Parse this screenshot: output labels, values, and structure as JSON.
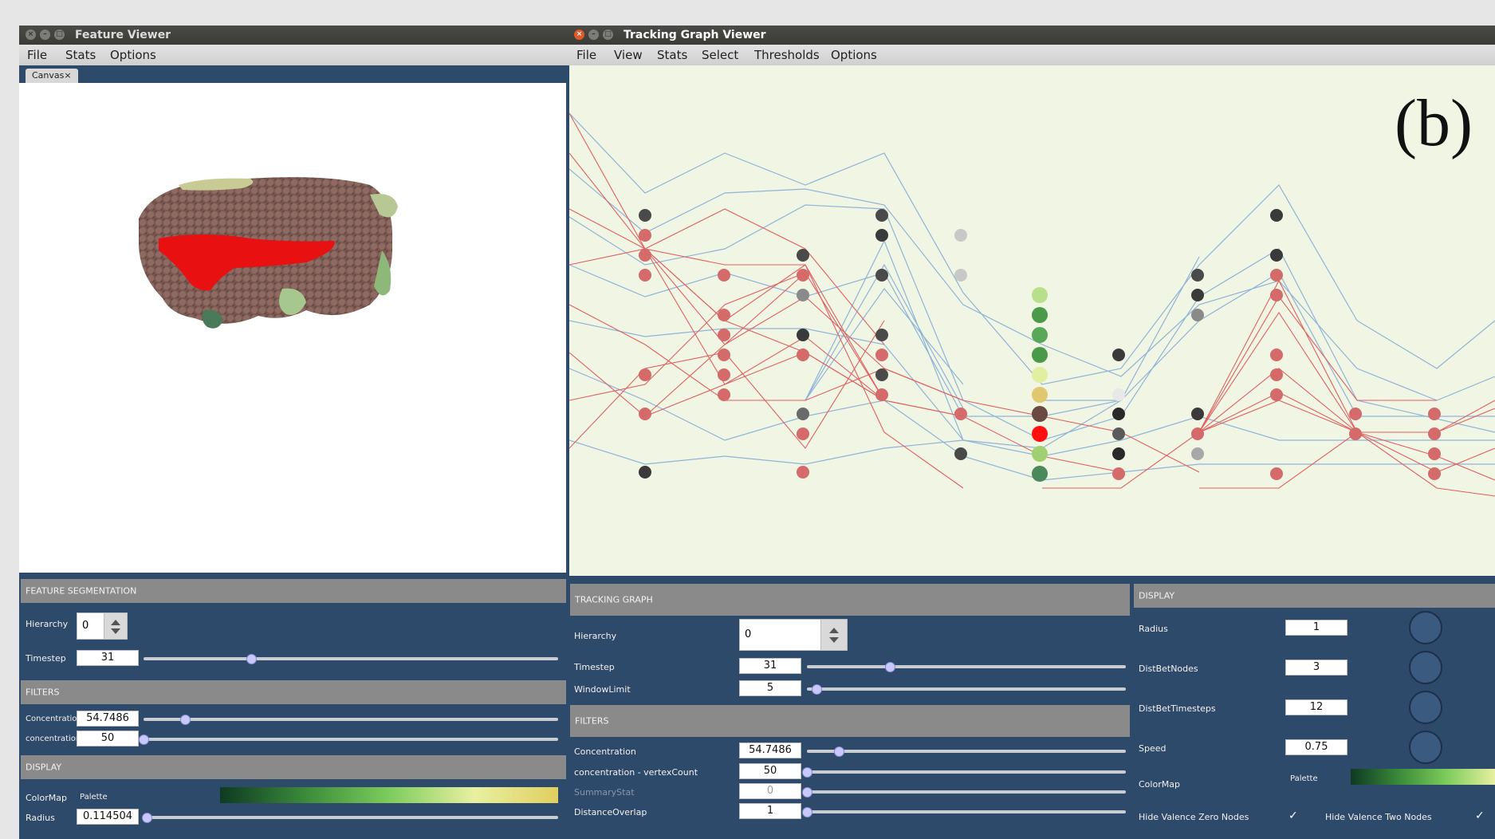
{
  "feature_viewer": {
    "title": "Feature Viewer",
    "menu": [
      "File",
      "Stats",
      "Options"
    ],
    "tab": "Canvas",
    "segmentation": {
      "header": "FEATURE SEGMENTATION",
      "hierarchy_label": "Hierarchy",
      "hierarchy_value": "0",
      "timestep_label": "Timestep",
      "timestep_value": "31",
      "timestep_slider": 0.26
    },
    "filters": {
      "header": "FILTERS",
      "concentration_label": "Concentration",
      "concentration_value": "54.7486",
      "concentration_slider": 0.1,
      "count_label": "concentration...",
      "count_value": "50",
      "count_slider": 0.0
    },
    "display": {
      "header": "DISPLAY",
      "colormap_label": "ColorMap",
      "palette_label": "Palette",
      "radius_label": "Radius",
      "radius_value": "0.114504",
      "radius_slider": 0.0
    }
  },
  "tracking_viewer": {
    "title": "Tracking Graph Viewer",
    "menu": [
      "File",
      "View",
      "Stats",
      "Select",
      "Thresholds",
      "Options"
    ],
    "figure_label": "(b)",
    "graph": {
      "header": "TRACKING GRAPH",
      "hierarchy_label": "Hierarchy",
      "hierarchy_value": "0",
      "timestep_label": "Timestep",
      "timestep_value": "31",
      "timestep_slider": 0.26,
      "window_label": "WindowLimit",
      "window_value": "5",
      "window_slider": 0.03
    },
    "filters": {
      "header": "FILTERS",
      "concentration_label": "Concentration",
      "concentration_value": "54.7486",
      "concentration_slider": 0.1,
      "vertex_label": "concentration - vertexCount",
      "vertex_value": "50",
      "vertex_slider": 0.0,
      "summary_label": "SummaryStat",
      "summary_value": "0",
      "summary_slider": 0.0,
      "overlap_label": "DistanceOverlap",
      "overlap_value": "1",
      "overlap_slider": 0.0
    },
    "display": {
      "header": "DISPLAY",
      "radius_label": "Radius",
      "radius_value": "1",
      "distnodes_label": "DistBetNodes",
      "distnodes_value": "3",
      "disttimesteps_label": "DistBetTimesteps",
      "disttimesteps_value": "12",
      "speed_label": "Speed",
      "speed_value": "0.75",
      "colormap_label": "ColorMap",
      "palette_label": "Palette",
      "hide_zero_label": "Hide Valence Zero Nodes",
      "hide_zero_checked": true,
      "hide_two_label": "Hide Valence Two Nodes",
      "hide_two_checked": true
    }
  },
  "colors": {
    "panel_bg": "#2e4a6b",
    "graph_bg": "#f0f5e4",
    "header_gray": "#8a8a8a",
    "red_edge": "#e06060",
    "blue_edge": "#8fb4d8"
  }
}
